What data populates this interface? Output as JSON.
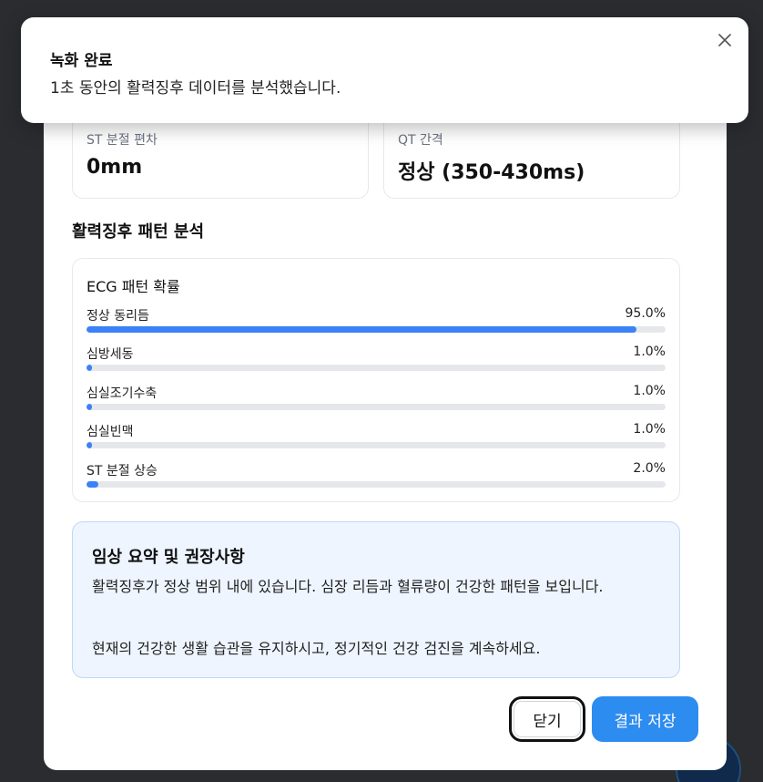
{
  "toast": {
    "title": "녹화 완료",
    "message": "1초 동안의 활력징후 데이터를 분석했습니다."
  },
  "metrics": [
    {
      "label": "ST 분절 편차",
      "value": "0mm"
    },
    {
      "label": "QT 간격",
      "value": "정상 (350-430ms)"
    }
  ],
  "pattern_section": {
    "title": "활력징후 패턴 분석",
    "card_title": "ECG 패턴 확률",
    "items": [
      {
        "label": "정상 동리듬",
        "value": "95.0%",
        "fraction": 0.95
      },
      {
        "label": "심방세동",
        "value": "1.0%",
        "fraction": 0.01
      },
      {
        "label": "심실조기수축",
        "value": "1.0%",
        "fraction": 0.01
      },
      {
        "label": "심실빈맥",
        "value": "1.0%",
        "fraction": 0.01
      },
      {
        "label": "ST 분절 상승",
        "value": "2.0%",
        "fraction": 0.02
      }
    ]
  },
  "summary": {
    "title": "임상 요약 및 권장사항",
    "paragraph1": "활력징후가 정상 범위 내에 있습니다. 심장 리듬과 혈류량이 건강한 패턴을 보입니다.",
    "paragraph2": "현재의 건강한 생활 습관을 유지하시고, 정기적인 건강 검진을 계속하세요."
  },
  "buttons": {
    "close": "닫기",
    "save": "결과 저장"
  },
  "colors": {
    "accent": "#2d8cf0",
    "bar_fill": "#3b82f6",
    "track": "#e5e7eb",
    "summary_bg": "#eef5ff"
  }
}
